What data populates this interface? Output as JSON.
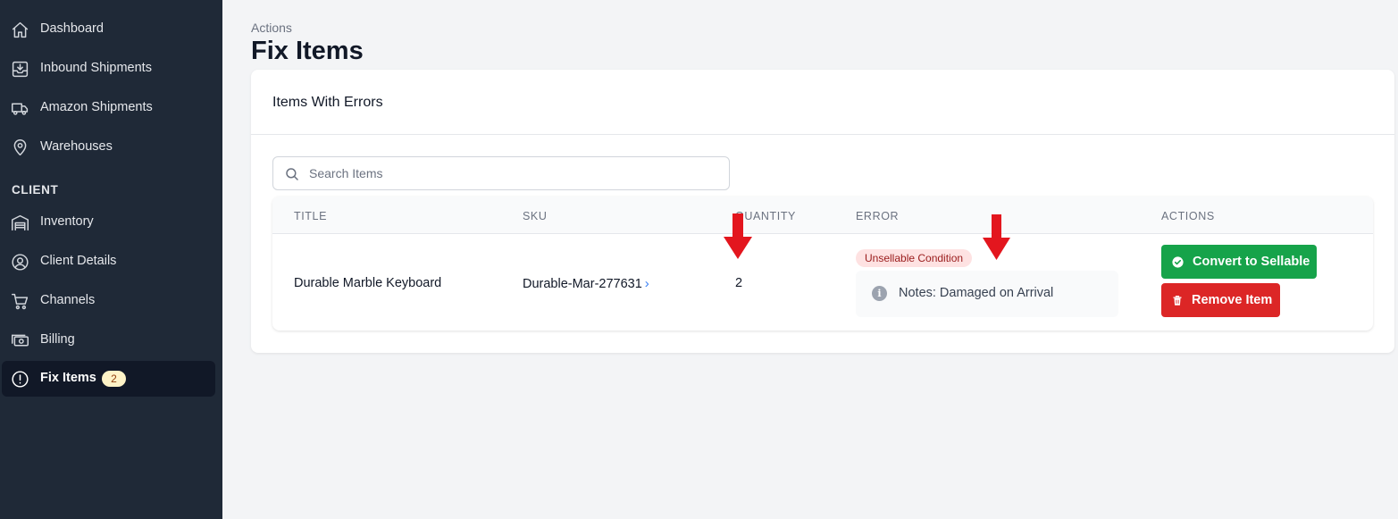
{
  "sidebar": {
    "items": [
      {
        "label": "Dashboard",
        "icon": "home-icon"
      },
      {
        "label": "Inbound Shipments",
        "icon": "inbox-icon"
      },
      {
        "label": "Amazon Shipments",
        "icon": "truck-icon"
      },
      {
        "label": "Warehouses",
        "icon": "map-pin-icon"
      }
    ],
    "section_label": "CLIENT",
    "client_items": [
      {
        "label": "Inventory",
        "icon": "warehouse-icon"
      },
      {
        "label": "Client Details",
        "icon": "user-circle-icon"
      },
      {
        "label": "Channels",
        "icon": "cart-icon"
      },
      {
        "label": "Billing",
        "icon": "cash-icon"
      },
      {
        "label": "Fix Items",
        "icon": "exclamation-circle-icon",
        "badge": "2",
        "active": true
      }
    ]
  },
  "header": {
    "breadcrumb": "Actions",
    "title": "Fix Items"
  },
  "card": {
    "title": "Items With Errors",
    "search_placeholder": "Search Items",
    "search_value": ""
  },
  "table": {
    "columns": [
      "TITLE",
      "SKU",
      "QUANTITY",
      "ERROR",
      "ACTIONS"
    ],
    "rows": [
      {
        "title": "Durable Marble Keyboard",
        "sku": "Durable-Mar-277631",
        "quantity": "2",
        "error_badge": "Unsellable Condition",
        "notes": "Notes: Damaged on Arrival",
        "actions": {
          "convert_label": "Convert to Sellable",
          "remove_label": "Remove Item"
        }
      }
    ]
  },
  "colors": {
    "sidebar_bg": "#1f2937",
    "active_bg": "#111827",
    "convert_green": "#16a34a",
    "remove_red": "#dc2626",
    "annotation_arrow": "#e3161e"
  }
}
